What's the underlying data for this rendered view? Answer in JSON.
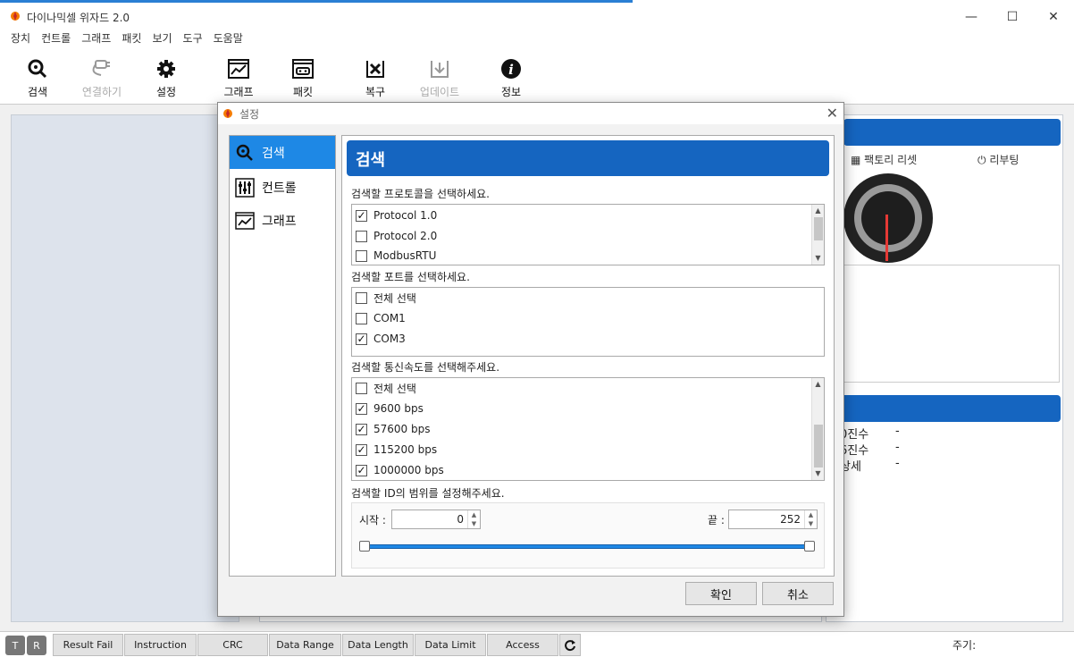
{
  "app": {
    "title": "다이나믹셀 위자드 2.0",
    "minimize": "—",
    "maximize": "☐",
    "close": "✕"
  },
  "menu": [
    "장치",
    "컨트롤",
    "그래프",
    "패킷",
    "보기",
    "도구",
    "도움말"
  ],
  "toolbar": [
    {
      "label": "검색",
      "icon": "search-icon",
      "enabled": true
    },
    {
      "label": "연결하기",
      "icon": "plug-icon",
      "enabled": false
    },
    {
      "label": "설정",
      "icon": "gear-icon",
      "enabled": true
    },
    {
      "label": "그래프",
      "icon": "graph-icon",
      "enabled": true
    },
    {
      "label": "패킷",
      "icon": "packet-icon",
      "enabled": true
    },
    {
      "label": "복구",
      "icon": "recovery-icon",
      "enabled": true
    },
    {
      "label": "업데이트",
      "icon": "update-icon",
      "enabled": false
    },
    {
      "label": "정보",
      "icon": "info-icon",
      "enabled": true
    }
  ],
  "right_panel": {
    "factory_reset": "팩토리 리셋",
    "reboot": "리부팅",
    "info_rows": [
      {
        "label": "0진수",
        "value": "-"
      },
      {
        "label": "6진수",
        "value": "-"
      },
      {
        "label": "상세",
        "value": "-"
      }
    ]
  },
  "dialog": {
    "title": "설정",
    "close": "✕",
    "nav": [
      {
        "label": "검색",
        "icon": "search-icon",
        "active": true
      },
      {
        "label": "컨트롤",
        "icon": "control-icon",
        "active": false
      },
      {
        "label": "그래프",
        "icon": "graph-icon",
        "active": false
      }
    ],
    "header": "검색",
    "protocol": {
      "label": "검색할 프로토콜을 선택하세요.",
      "items": [
        {
          "text": "Protocol 1.0",
          "checked": true
        },
        {
          "text": "Protocol 2.0",
          "checked": false
        },
        {
          "text": "ModbusRTU",
          "checked": false
        }
      ]
    },
    "port": {
      "label": "검색할 포트를 선택하세요.",
      "items": [
        {
          "text": "전체 선택",
          "checked": false
        },
        {
          "text": "COM1",
          "checked": false
        },
        {
          "text": "COM3",
          "checked": true
        }
      ]
    },
    "baud": {
      "label": "검색할 통신속도를 선택해주세요.",
      "items": [
        {
          "text": "전체 선택",
          "checked": false
        },
        {
          "text": "9600 bps",
          "checked": true
        },
        {
          "text": "57600 bps",
          "checked": true
        },
        {
          "text": "115200 bps",
          "checked": true
        },
        {
          "text": "1000000 bps",
          "checked": true
        }
      ]
    },
    "id_range": {
      "label": "검색할 ID의 범위를 설정해주세요.",
      "start_label": "시작 :",
      "start_value": "0",
      "end_label": "끝 :",
      "end_value": "252"
    },
    "ok": "확인",
    "cancel": "취소"
  },
  "statusbar": {
    "t": "T",
    "r": "R",
    "buttons": [
      "Result Fail",
      "Instruction",
      "CRC",
      "Data Range",
      "Data Length",
      "Data Limit",
      "Access"
    ],
    "refresh_icon": "refresh-icon",
    "period_label": "주기:"
  },
  "colors": {
    "accent": "#1565c0",
    "nav_active": "#1e88e5",
    "needle": "#e53935"
  }
}
